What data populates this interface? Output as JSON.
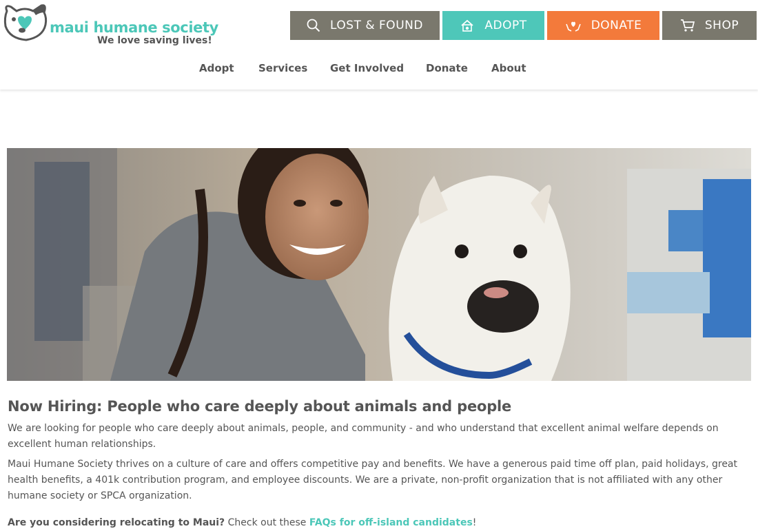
{
  "brand": {
    "name": "maui humane society",
    "tagline": "We love saving lives!",
    "colors": {
      "teal": "#4cc7b8",
      "orange": "#f37a3b",
      "gray": "#7a786d"
    }
  },
  "top_buttons": {
    "lost_found": {
      "label": "LOST & FOUND",
      "icon": "search-icon"
    },
    "adopt": {
      "label": "ADOPT",
      "icon": "dog-house-icon"
    },
    "donate": {
      "label": "DONATE",
      "icon": "hands-heart-icon"
    },
    "shop": {
      "label": "SHOP",
      "icon": "cart-icon"
    }
  },
  "nav": [
    "Adopt",
    "Services",
    "Get Involved",
    "Donate",
    "About"
  ],
  "hero": {
    "description": "Smiling woman hugging a white dog"
  },
  "main": {
    "heading": "Now Hiring: People who care deeply about animals and people",
    "paragraph1": "We are looking for people who care deeply about animals, people, and community - and who understand that excellent animal welfare depends on excellent human relationships.",
    "paragraph2": "Maui Humane Society thrives on a culture of care and offers competitive pay and benefits. We have a generous paid time off plan, paid holidays, great health benefits, a 401k contribution program, and employee discounts. We are a private, non-profit organization that is not affiliated with any other humane society or SPCA organization.",
    "relocate_question": "Are you considering relocating to Maui?",
    "relocate_text": " Check out these ",
    "relocate_link": "FAQs for off-island candidates",
    "relocate_end": "!"
  }
}
